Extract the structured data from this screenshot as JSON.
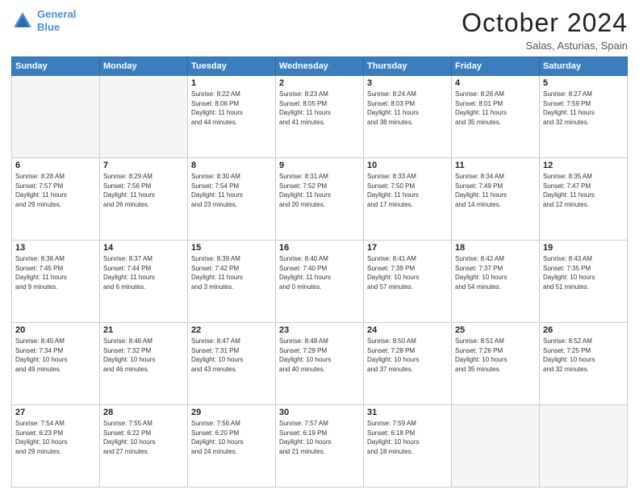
{
  "header": {
    "logo_line1": "General",
    "logo_line2": "Blue",
    "month": "October 2024",
    "location": "Salas, Asturias, Spain"
  },
  "weekdays": [
    "Sunday",
    "Monday",
    "Tuesday",
    "Wednesday",
    "Thursday",
    "Friday",
    "Saturday"
  ],
  "weeks": [
    [
      {
        "day": "",
        "text": ""
      },
      {
        "day": "",
        "text": ""
      },
      {
        "day": "1",
        "text": "Sunrise: 8:22 AM\nSunset: 8:06 PM\nDaylight: 11 hours\nand 44 minutes."
      },
      {
        "day": "2",
        "text": "Sunrise: 8:23 AM\nSunset: 8:05 PM\nDaylight: 11 hours\nand 41 minutes."
      },
      {
        "day": "3",
        "text": "Sunrise: 8:24 AM\nSunset: 8:03 PM\nDaylight: 11 hours\nand 38 minutes."
      },
      {
        "day": "4",
        "text": "Sunrise: 8:26 AM\nSunset: 8:01 PM\nDaylight: 11 hours\nand 35 minutes."
      },
      {
        "day": "5",
        "text": "Sunrise: 8:27 AM\nSunset: 7:59 PM\nDaylight: 11 hours\nand 32 minutes."
      }
    ],
    [
      {
        "day": "6",
        "text": "Sunrise: 8:28 AM\nSunset: 7:57 PM\nDaylight: 11 hours\nand 29 minutes."
      },
      {
        "day": "7",
        "text": "Sunrise: 8:29 AM\nSunset: 7:56 PM\nDaylight: 11 hours\nand 26 minutes."
      },
      {
        "day": "8",
        "text": "Sunrise: 8:30 AM\nSunset: 7:54 PM\nDaylight: 11 hours\nand 23 minutes."
      },
      {
        "day": "9",
        "text": "Sunrise: 8:31 AM\nSunset: 7:52 PM\nDaylight: 11 hours\nand 20 minutes."
      },
      {
        "day": "10",
        "text": "Sunrise: 8:33 AM\nSunset: 7:50 PM\nDaylight: 11 hours\nand 17 minutes."
      },
      {
        "day": "11",
        "text": "Sunrise: 8:34 AM\nSunset: 7:49 PM\nDaylight: 11 hours\nand 14 minutes."
      },
      {
        "day": "12",
        "text": "Sunrise: 8:35 AM\nSunset: 7:47 PM\nDaylight: 11 hours\nand 12 minutes."
      }
    ],
    [
      {
        "day": "13",
        "text": "Sunrise: 8:36 AM\nSunset: 7:45 PM\nDaylight: 11 hours\nand 9 minutes."
      },
      {
        "day": "14",
        "text": "Sunrise: 8:37 AM\nSunset: 7:44 PM\nDaylight: 11 hours\nand 6 minutes."
      },
      {
        "day": "15",
        "text": "Sunrise: 8:39 AM\nSunset: 7:42 PM\nDaylight: 11 hours\nand 3 minutes."
      },
      {
        "day": "16",
        "text": "Sunrise: 8:40 AM\nSunset: 7:40 PM\nDaylight: 11 hours\nand 0 minutes."
      },
      {
        "day": "17",
        "text": "Sunrise: 8:41 AM\nSunset: 7:39 PM\nDaylight: 10 hours\nand 57 minutes."
      },
      {
        "day": "18",
        "text": "Sunrise: 8:42 AM\nSunset: 7:37 PM\nDaylight: 10 hours\nand 54 minutes."
      },
      {
        "day": "19",
        "text": "Sunrise: 8:43 AM\nSunset: 7:35 PM\nDaylight: 10 hours\nand 51 minutes."
      }
    ],
    [
      {
        "day": "20",
        "text": "Sunrise: 8:45 AM\nSunset: 7:34 PM\nDaylight: 10 hours\nand 49 minutes."
      },
      {
        "day": "21",
        "text": "Sunrise: 8:46 AM\nSunset: 7:32 PM\nDaylight: 10 hours\nand 46 minutes."
      },
      {
        "day": "22",
        "text": "Sunrise: 8:47 AM\nSunset: 7:31 PM\nDaylight: 10 hours\nand 43 minutes."
      },
      {
        "day": "23",
        "text": "Sunrise: 8:48 AM\nSunset: 7:29 PM\nDaylight: 10 hours\nand 40 minutes."
      },
      {
        "day": "24",
        "text": "Sunrise: 8:50 AM\nSunset: 7:28 PM\nDaylight: 10 hours\nand 37 minutes."
      },
      {
        "day": "25",
        "text": "Sunrise: 8:51 AM\nSunset: 7:26 PM\nDaylight: 10 hours\nand 35 minutes."
      },
      {
        "day": "26",
        "text": "Sunrise: 8:52 AM\nSunset: 7:25 PM\nDaylight: 10 hours\nand 32 minutes."
      }
    ],
    [
      {
        "day": "27",
        "text": "Sunrise: 7:54 AM\nSunset: 6:23 PM\nDaylight: 10 hours\nand 29 minutes."
      },
      {
        "day": "28",
        "text": "Sunrise: 7:55 AM\nSunset: 6:22 PM\nDaylight: 10 hours\nand 27 minutes."
      },
      {
        "day": "29",
        "text": "Sunrise: 7:56 AM\nSunset: 6:20 PM\nDaylight: 10 hours\nand 24 minutes."
      },
      {
        "day": "30",
        "text": "Sunrise: 7:57 AM\nSunset: 6:19 PM\nDaylight: 10 hours\nand 21 minutes."
      },
      {
        "day": "31",
        "text": "Sunrise: 7:59 AM\nSunset: 6:18 PM\nDaylight: 10 hours\nand 18 minutes."
      },
      {
        "day": "",
        "text": ""
      },
      {
        "day": "",
        "text": ""
      }
    ]
  ]
}
